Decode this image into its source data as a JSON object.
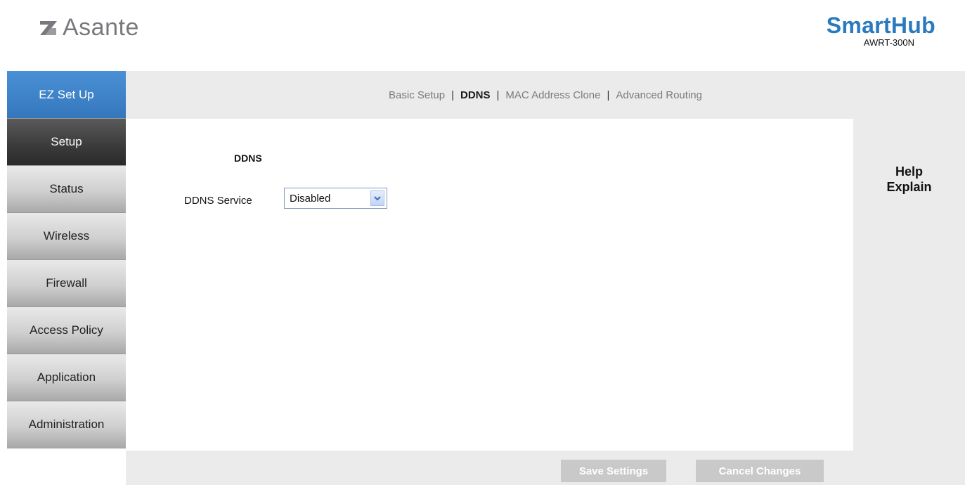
{
  "header": {
    "logo_text": "Asante",
    "brand_title": "SmartHub",
    "model": "AWRT-300N"
  },
  "sidebar": {
    "items": [
      {
        "label": "EZ Set Up"
      },
      {
        "label": "Setup"
      },
      {
        "label": "Status"
      },
      {
        "label": "Wireless"
      },
      {
        "label": "Firewall"
      },
      {
        "label": "Access Policy"
      },
      {
        "label": "Application"
      },
      {
        "label": "Administration"
      }
    ],
    "active": "Setup"
  },
  "tabs": {
    "items": [
      {
        "label": "Basic Setup"
      },
      {
        "label": "DDNS"
      },
      {
        "label": "MAC Address Clone"
      },
      {
        "label": "Advanced Routing"
      }
    ],
    "separator": "|",
    "current": "DDNS"
  },
  "main": {
    "section_title": "DDNS",
    "ddns_service_label": "DDNS Service",
    "ddns_service_value": "Disabled"
  },
  "help": {
    "line1": "Help",
    "line2": "Explain"
  },
  "footer": {
    "save_label": "Save Settings",
    "cancel_label": "Cancel Changes"
  },
  "colors": {
    "brand_blue": "#2a7ac0",
    "ez_setup_blue": "#3a80c6",
    "active_nav": "#3a3a3a",
    "panel_gray": "#ebebeb",
    "button_gray": "#c9c9c9"
  }
}
